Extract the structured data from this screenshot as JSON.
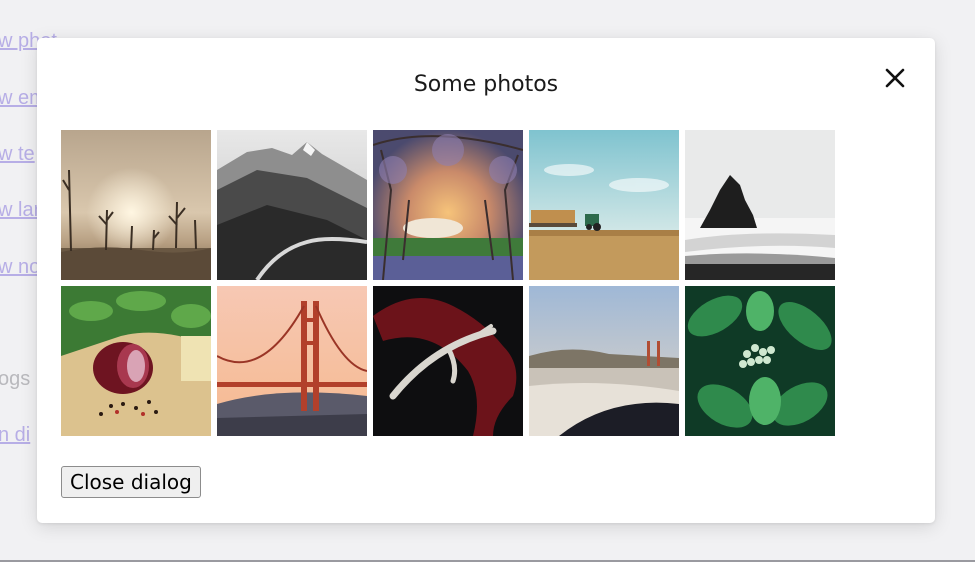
{
  "background": {
    "links": [
      "w phot",
      "w em",
      "w te",
      "w lar",
      "w no"
    ],
    "texts": [
      "ogs"
    ],
    "link_bottom": "n di"
  },
  "dialog": {
    "title": "Some photos",
    "close_button_label": "Close dialog",
    "close_icon": "close-icon",
    "photos": [
      {
        "name": "foggy-dead-trees"
      },
      {
        "name": "bw-mountain-road"
      },
      {
        "name": "cherry-blossom-tunnel"
      },
      {
        "name": "tractor-hay-field"
      },
      {
        "name": "sea-stack-black-beach"
      },
      {
        "name": "red-onion-spices"
      },
      {
        "name": "golden-gate-sunset"
      },
      {
        "name": "red-ribbon-antler"
      },
      {
        "name": "beach-golden-gate"
      },
      {
        "name": "green-plant-buds"
      }
    ]
  },
  "colors": {
    "link": "#b7aee6",
    "dialog_bg": "#ffffff",
    "page_bg": "#f1f1f3"
  }
}
